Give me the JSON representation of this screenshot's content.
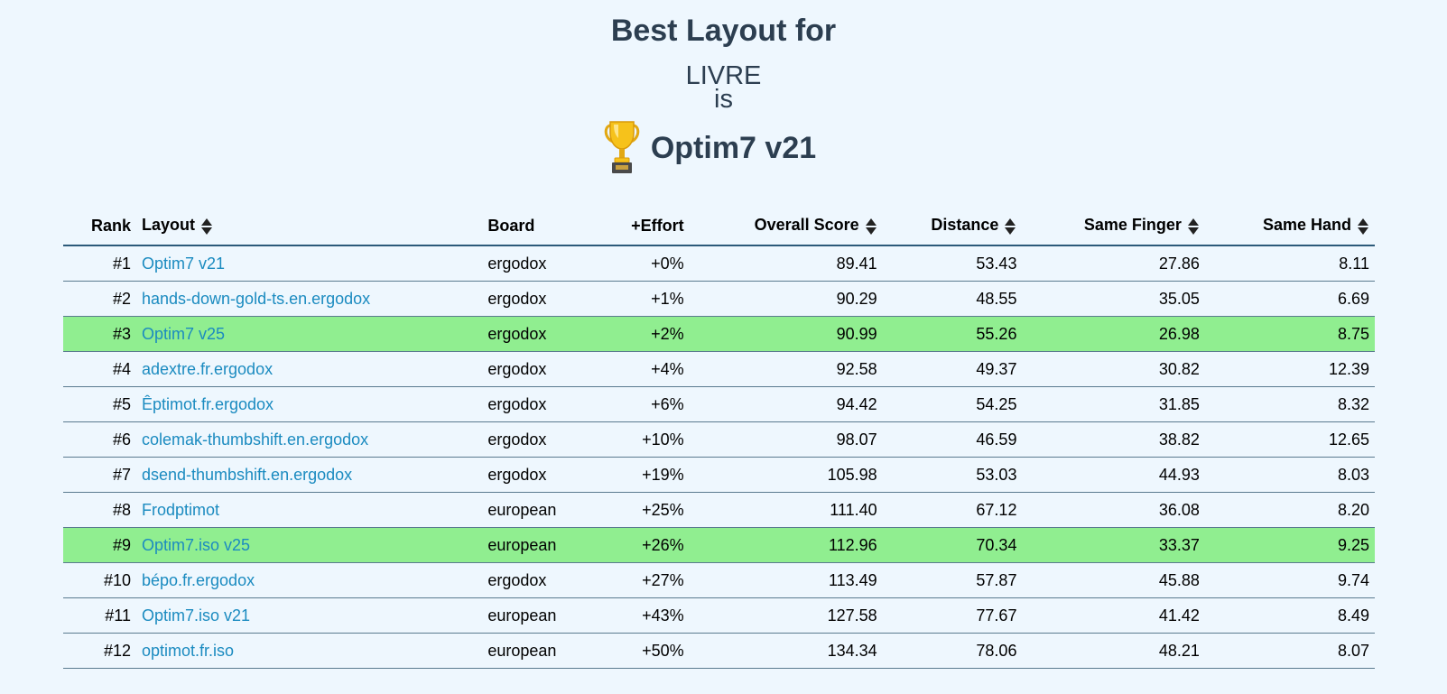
{
  "header": {
    "title": "Best Layout for",
    "corpus": "LIVRE",
    "is_text": "is",
    "winner": "Optim7 v21",
    "trophy_icon": "trophy-icon"
  },
  "colors": {
    "background": "#eef7fe",
    "heading": "#2c3e50",
    "link": "#1b8bc0",
    "highlight": "#90ee90"
  },
  "table": {
    "columns": {
      "rank": "Rank",
      "layout": "Layout",
      "board": "Board",
      "effort": "+Effort",
      "overall": "Overall Score",
      "distance": "Distance",
      "same_finger": "Same Finger",
      "same_hand": "Same Hand"
    },
    "rows": [
      {
        "rank": "#1",
        "layout": "Optim7 v21",
        "board": "ergodox",
        "effort": "+0%",
        "overall": "89.41",
        "distance": "53.43",
        "same_finger": "27.86",
        "same_hand": "8.11"
      },
      {
        "rank": "#2",
        "layout": "hands-down-gold-ts.en.ergodox",
        "board": "ergodox",
        "effort": "+1%",
        "overall": "90.29",
        "distance": "48.55",
        "same_finger": "35.05",
        "same_hand": "6.69"
      },
      {
        "rank": "#3",
        "layout": "Optim7 v25",
        "board": "ergodox",
        "effort": "+2%",
        "overall": "90.99",
        "distance": "55.26",
        "same_finger": "26.98",
        "same_hand": "8.75"
      },
      {
        "rank": "#4",
        "layout": "adextre.fr.ergodox",
        "board": "ergodox",
        "effort": "+4%",
        "overall": "92.58",
        "distance": "49.37",
        "same_finger": "30.82",
        "same_hand": "12.39"
      },
      {
        "rank": "#5",
        "layout": "Êptimot.fr.ergodox",
        "board": "ergodox",
        "effort": "+6%",
        "overall": "94.42",
        "distance": "54.25",
        "same_finger": "31.85",
        "same_hand": "8.32"
      },
      {
        "rank": "#6",
        "layout": "colemak-thumbshift.en.ergodox",
        "board": "ergodox",
        "effort": "+10%",
        "overall": "98.07",
        "distance": "46.59",
        "same_finger": "38.82",
        "same_hand": "12.65"
      },
      {
        "rank": "#7",
        "layout": "dsend-thumbshift.en.ergodox",
        "board": "ergodox",
        "effort": "+19%",
        "overall": "105.98",
        "distance": "53.03",
        "same_finger": "44.93",
        "same_hand": "8.03"
      },
      {
        "rank": "#8",
        "layout": "Frodptimot",
        "board": "european",
        "effort": "+25%",
        "overall": "111.40",
        "distance": "67.12",
        "same_finger": "36.08",
        "same_hand": "8.20"
      },
      {
        "rank": "#9",
        "layout": "Optim7.iso v25",
        "board": "european",
        "effort": "+26%",
        "overall": "112.96",
        "distance": "70.34",
        "same_finger": "33.37",
        "same_hand": "9.25"
      },
      {
        "rank": "#10",
        "layout": "bépo.fr.ergodox",
        "board": "ergodox",
        "effort": "+27%",
        "overall": "113.49",
        "distance": "57.87",
        "same_finger": "45.88",
        "same_hand": "9.74"
      },
      {
        "rank": "#11",
        "layout": "Optim7.iso v21",
        "board": "european",
        "effort": "+43%",
        "overall": "127.58",
        "distance": "77.67",
        "same_finger": "41.42",
        "same_hand": "8.49"
      },
      {
        "rank": "#12",
        "layout": "optimot.fr.iso",
        "board": "european",
        "effort": "+50%",
        "overall": "134.34",
        "distance": "78.06",
        "same_finger": "48.21",
        "same_hand": "8.07"
      }
    ]
  }
}
